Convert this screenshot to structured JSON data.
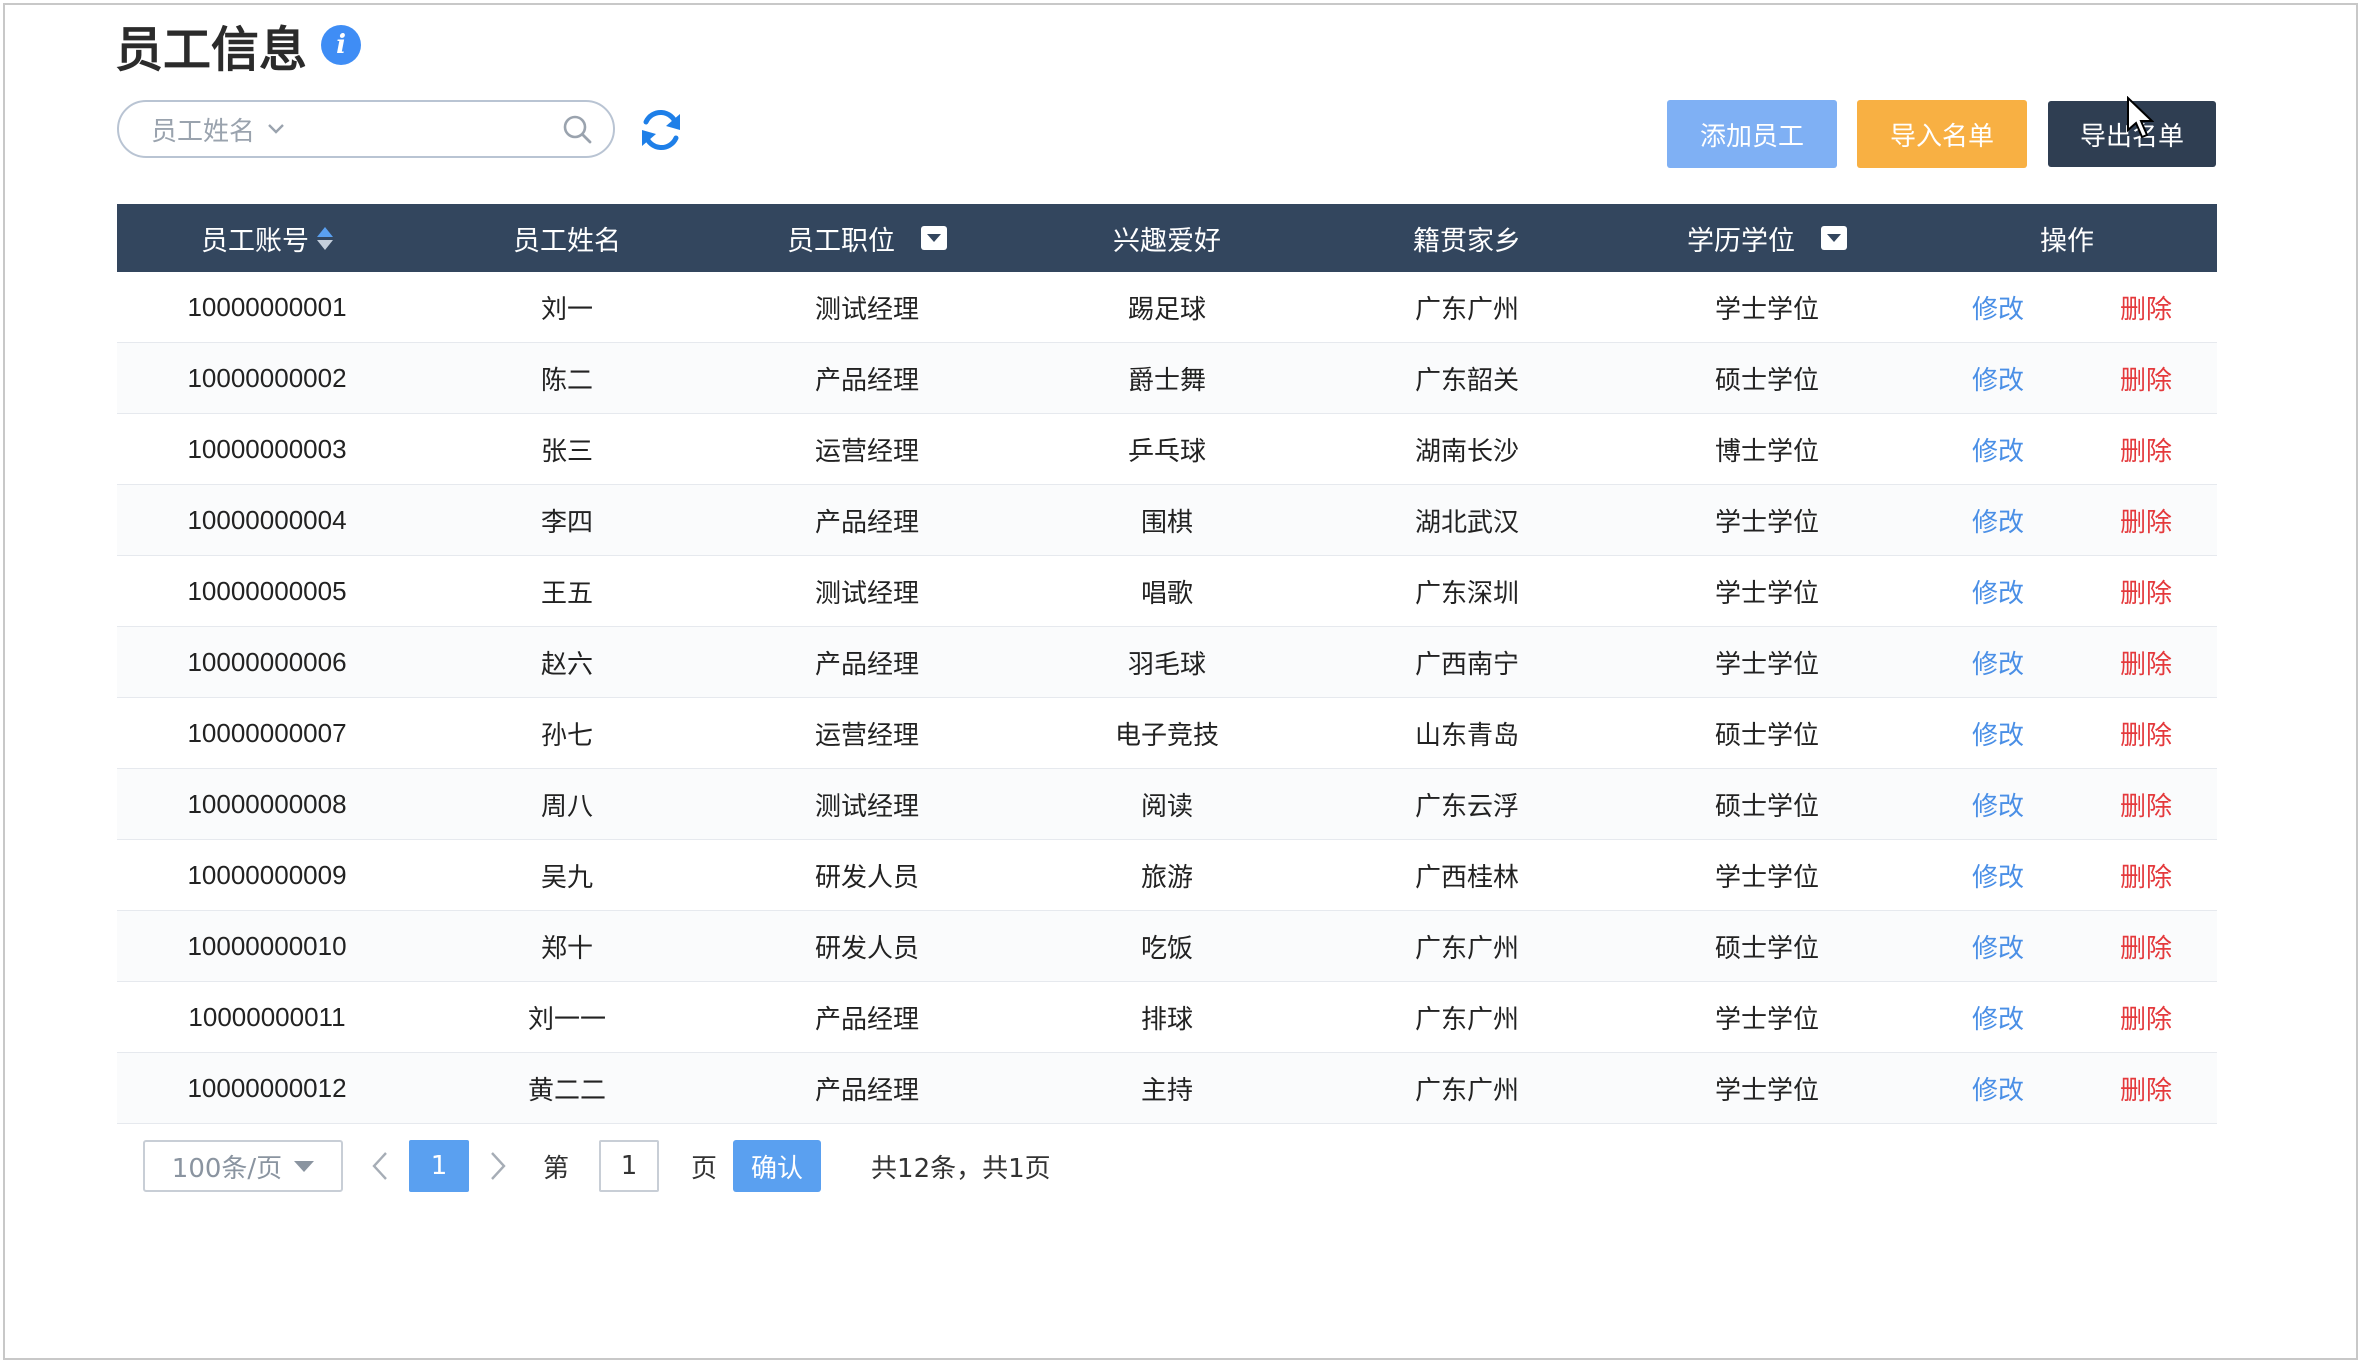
{
  "page": {
    "title": "员工信息"
  },
  "search": {
    "placeholder": "员工姓名"
  },
  "toolbar": {
    "add_label": "添加员工",
    "import_label": "导入名单",
    "export_label": "导出名单"
  },
  "colors": {
    "header_bg": "#33465e",
    "primary": "#5aa0f0",
    "add_btn": "#7fb0f4",
    "import_btn": "#f8b043",
    "export_btn": "#2f3e52",
    "edit_link": "#4a8fe6",
    "delete_link": "#e4393c"
  },
  "table": {
    "columns": [
      "员工账号",
      "员工姓名",
      "员工职位",
      "兴趣爱好",
      "籍贯家乡",
      "学历学位",
      "操作"
    ],
    "edit_label": "修改",
    "delete_label": "删除",
    "rows": [
      [
        "10000000001",
        "刘一",
        "测试经理",
        "踢足球",
        "广东广州",
        "学士学位"
      ],
      [
        "10000000002",
        "陈二",
        "产品经理",
        "爵士舞",
        "广东韶关",
        "硕士学位"
      ],
      [
        "10000000003",
        "张三",
        "运营经理",
        "乒乓球",
        "湖南长沙",
        "博士学位"
      ],
      [
        "10000000004",
        "李四",
        "产品经理",
        "围棋",
        "湖北武汉",
        "学士学位"
      ],
      [
        "10000000005",
        "王五",
        "测试经理",
        "唱歌",
        "广东深圳",
        "学士学位"
      ],
      [
        "10000000006",
        "赵六",
        "产品经理",
        "羽毛球",
        "广西南宁",
        "学士学位"
      ],
      [
        "10000000007",
        "孙七",
        "运营经理",
        "电子竞技",
        "山东青岛",
        "硕士学位"
      ],
      [
        "10000000008",
        "周八",
        "测试经理",
        "阅读",
        "广东云浮",
        "硕士学位"
      ],
      [
        "10000000009",
        "吴九",
        "研发人员",
        "旅游",
        "广西桂林",
        "学士学位"
      ],
      [
        "10000000010",
        "郑十",
        "研发人员",
        "吃饭",
        "广东广州",
        "硕士学位"
      ],
      [
        "10000000011",
        "刘一一",
        "产品经理",
        "排球",
        "广东广州",
        "学士学位"
      ],
      [
        "10000000012",
        "黄二二",
        "产品经理",
        "主持",
        "广东广州",
        "学士学位"
      ]
    ]
  },
  "pagination": {
    "page_size": "100条/页",
    "current_page": "1",
    "goto_prefix": "第",
    "goto_value": "1",
    "goto_suffix": "页",
    "confirm_label": "确认",
    "summary": "共12条，共1页"
  }
}
